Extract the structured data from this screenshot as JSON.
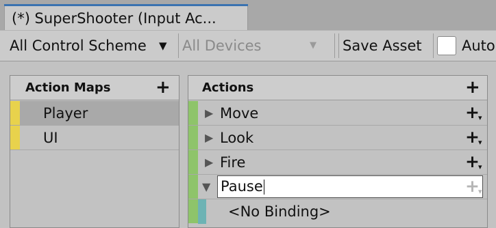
{
  "window": {
    "tab_title": "(*) SuperShooter (Input Ac..."
  },
  "toolbar": {
    "control_scheme": "All Control Scheme",
    "devices": "All Devices",
    "save_asset": "Save Asset",
    "auto_save_label": "Auto",
    "auto_save_checked": false
  },
  "action_maps": {
    "header": "Action Maps",
    "add_glyph": "+",
    "items": [
      {
        "label": "Player",
        "selected": true
      },
      {
        "label": "UI",
        "selected": false
      }
    ]
  },
  "actions": {
    "header": "Actions",
    "add_glyph": "+",
    "items": [
      {
        "label": "Move",
        "expanded": false
      },
      {
        "label": "Look",
        "expanded": false
      },
      {
        "label": "Fire",
        "expanded": false
      },
      {
        "label": "Pause",
        "expanded": true,
        "renaming": true
      }
    ],
    "bindings": [
      {
        "label": "<No Binding>"
      }
    ]
  },
  "colors": {
    "action_map_stripe": "#e8d24c",
    "action_stripe": "#8ec46a",
    "binding_stripe": "#6db3b4",
    "tab_accent": "#3a72b0"
  }
}
